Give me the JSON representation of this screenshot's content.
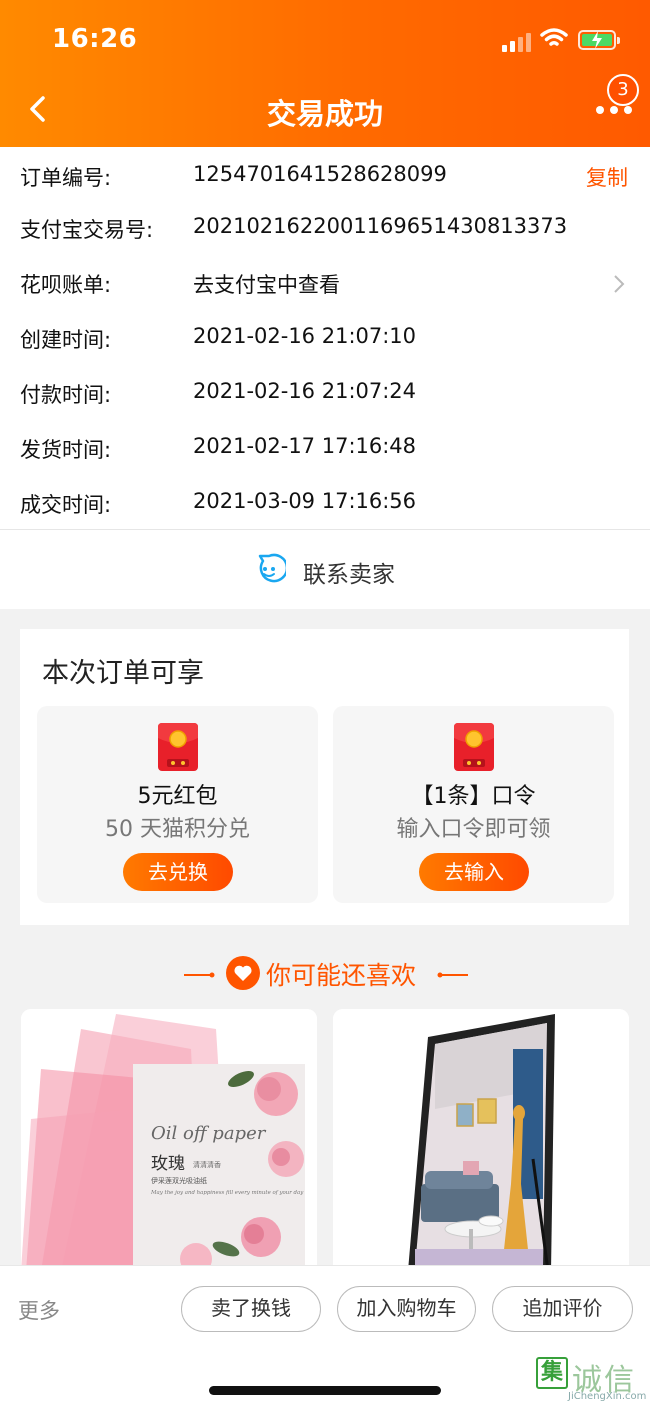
{
  "status_bar": {
    "time": "16:26"
  },
  "nav": {
    "title": "交易成功",
    "badge_count": "3",
    "back_icon": "chevron-left-icon",
    "more_icon": "more-dots-icon"
  },
  "order": {
    "rows": [
      {
        "label": "订单编号:",
        "value": "1254701641528628099"
      },
      {
        "label": "支付宝交易号:",
        "value": "2021021622001169651430813373"
      },
      {
        "label": "花呗账单:",
        "value": "去支付宝中查看"
      },
      {
        "label": "创建时间:",
        "value": "2021-02-16 21:07:10"
      },
      {
        "label": "付款时间:",
        "value": "2021-02-16 21:07:24"
      },
      {
        "label": "发货时间:",
        "value": "2021-02-17 17:16:48"
      },
      {
        "label": "成交时间:",
        "value": "2021-03-09 17:16:56"
      }
    ],
    "copy_label": "复制",
    "contact_label": "联系卖家"
  },
  "benefits": {
    "title": "本次订单可享",
    "cards": [
      {
        "name": "5元红包",
        "sub": "50 天猫积分兑",
        "button": "去兑换",
        "icon": "red-packet-icon"
      },
      {
        "name": "【1条】口令",
        "sub": "输入口令即可领",
        "button": "去输入",
        "icon": "red-packet-icon"
      }
    ]
  },
  "recommend": {
    "title": "你可能还喜欢",
    "products": [
      {
        "image_text_1": "Oil off paper",
        "image_text_2": "玫瑰",
        "image_text_3": "清清清香",
        "image_text_4": "伊采莲双光吸油纸",
        "image_text_5": "May the joy and happiness fill every minute of your day"
      },
      {
        "image_kind": "floor-mirror"
      }
    ]
  },
  "bottom_bar": {
    "more": "更多",
    "buttons": [
      "卖了换钱",
      "加入购物车",
      "追加评价"
    ]
  },
  "watermark": {
    "chars": "诚信",
    "sub": "JiChengXin.com",
    "icon_char": "集"
  },
  "colors": {
    "accent": "#ff5500",
    "header_start": "#ff8a00",
    "header_end": "#ff5a00"
  }
}
